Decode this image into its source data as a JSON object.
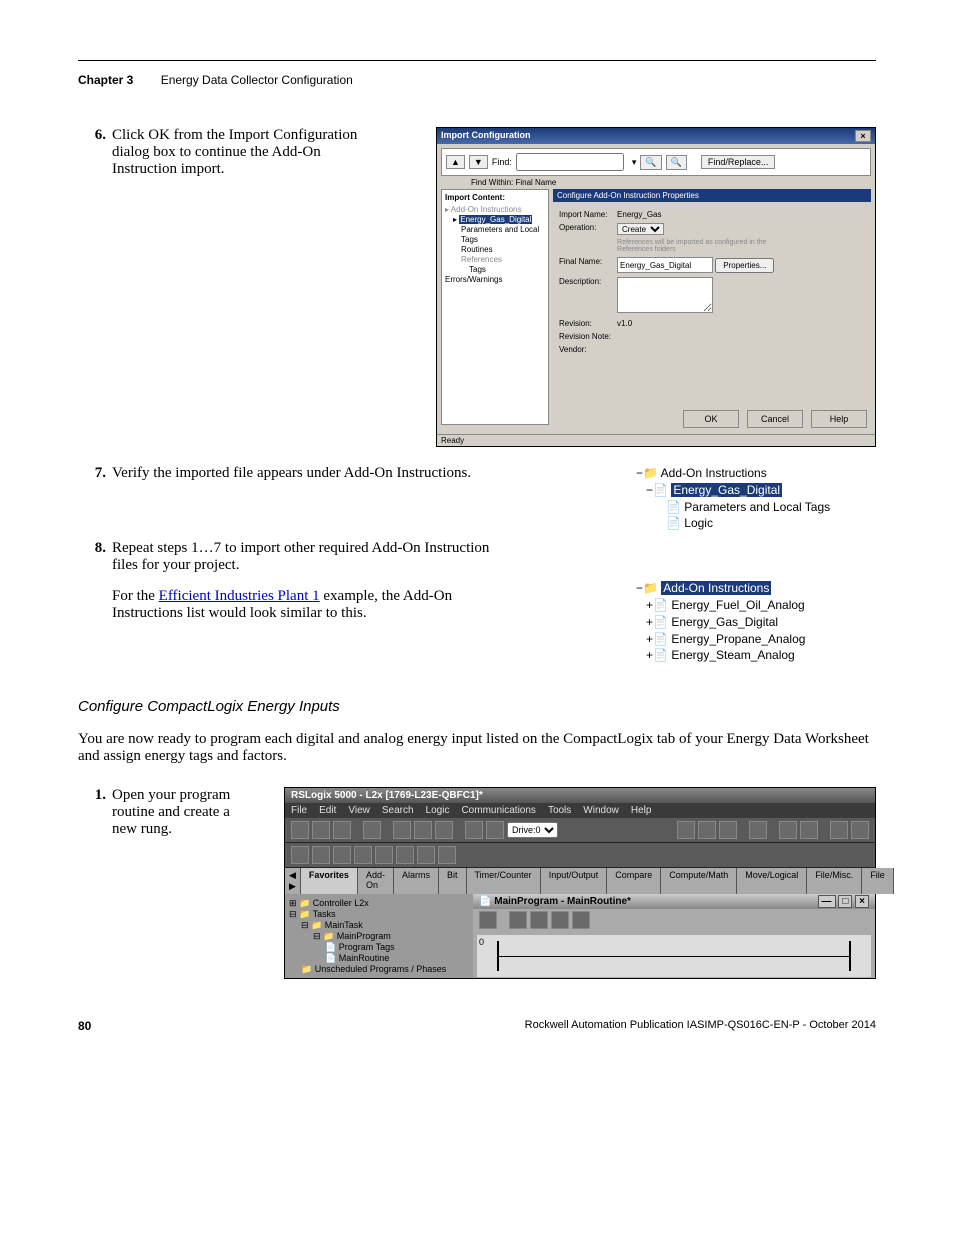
{
  "header": {
    "chapter": "Chapter 3",
    "title": "Energy Data Collector Configuration"
  },
  "steps": {
    "s6": {
      "num": "6.",
      "text": "Click OK from the Import Configuration dialog box to continue the Add-On Instruction import."
    },
    "s7": {
      "num": "7.",
      "text": "Verify the imported file appears under Add-On Instructions."
    },
    "s8": {
      "num": "8.",
      "text1": "Repeat steps 1…7 to import other required Add-On Instruction files for your project.",
      "text2a": "For the ",
      "link": "Efficient Industries Plant 1",
      "text2b": " example, the Add-On Instructions list would look similar to this."
    },
    "s1b": {
      "num": "1.",
      "text": "Open your program routine and create a new rung."
    }
  },
  "dialog": {
    "title": "Import Configuration",
    "find_label": "Find:",
    "findwithin": "Find Within: Final Name",
    "findreplace_btn": "Find/Replace...",
    "left_header": "Import Content:",
    "tree": {
      "root": "Add-On Instructions",
      "sel": "Energy_Gas_Digital",
      "i1": "Parameters and Local Tags",
      "i2": "Routines",
      "i3": "References",
      "i4": "Tags",
      "err": "Errors/Warnings"
    },
    "right_header": "Configure Add-On Instruction Properties",
    "fields": {
      "import_name_l": "Import Name:",
      "import_name_v": "Energy_Gas",
      "operation_l": "Operation:",
      "operation_v": "Create",
      "op_note": "References will be imported as configured in the References folders",
      "final_name_l": "Final Name:",
      "final_name_v": "Energy_Gas_Digital",
      "properties_btn": "Properties...",
      "description_l": "Description:",
      "revision_l": "Revision:",
      "revision_v": "v1.0",
      "revnote_l": "Revision Note:",
      "vendor_l": "Vendor:"
    },
    "buttons": {
      "ok": "OK",
      "cancel": "Cancel",
      "help": "Help"
    },
    "status": "Ready"
  },
  "tree1": {
    "root": "Add-On Instructions",
    "sel": "Energy_Gas_Digital",
    "c1": "Parameters and Local Tags",
    "c2": "Logic"
  },
  "tree2": {
    "root": "Add-On Instructions",
    "c1": "Energy_Fuel_Oil_Analog",
    "c2": "Energy_Gas_Digital",
    "c3": "Energy_Propane_Analog",
    "c4": "Energy_Steam_Analog"
  },
  "section2": {
    "heading": "Configure CompactLogix Energy Inputs",
    "para": "You are now ready to program each digital and analog energy input listed on the CompactLogix tab of your Energy Data Worksheet and assign energy tags and factors."
  },
  "rslogix": {
    "title": "RSLogix 5000 - L2x [1769-L23E-QBFC1]*",
    "menus": [
      "File",
      "Edit",
      "View",
      "Search",
      "Logic",
      "Communications",
      "Tools",
      "Window",
      "Help"
    ],
    "drive": "Drive:0",
    "tabs": [
      "Favorites",
      "Add-On",
      "Alarms",
      "Bit",
      "Timer/Counter",
      "Input/Output",
      "Compare",
      "Compute/Math",
      "Move/Logical",
      "File/Misc.",
      "File"
    ],
    "lefttree": {
      "l1": "Controller L2x",
      "l2": "Tasks",
      "l3": "MainTask",
      "l4": "MainProgram",
      "l5": "Program Tags",
      "l6": "MainRoutine",
      "l7": "Unscheduled Programs / Phases"
    },
    "right_title": "MainProgram - MainRoutine*",
    "rung0": "0"
  },
  "footer": {
    "page": "80",
    "pub": "Rockwell Automation Publication IASIMP-QS016C-EN-P - October 2014"
  }
}
